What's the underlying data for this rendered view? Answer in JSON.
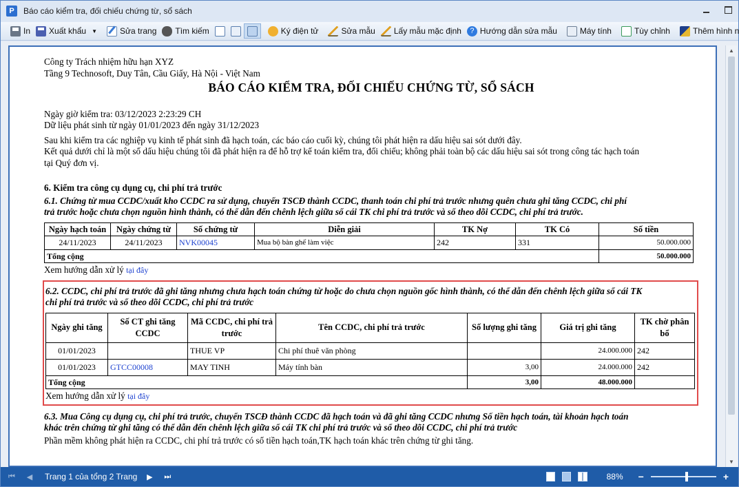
{
  "window": {
    "title": "Báo cáo kiểm tra, đối chiếu chứng từ, sổ sách",
    "app_icon_letter": "P"
  },
  "toolbar": {
    "print": "In",
    "export": "Xuất khẩu",
    "edit_template": "Sửa trang",
    "find": "Tìm kiếm",
    "sign": "Ký điện tử",
    "edit_form": "Sửa mẫu",
    "default_form": "Lấy mẫu mặc định",
    "guide": "Hướng dẫn sửa mẫu",
    "calculator": "Máy tính",
    "customize": "Tùy chỉnh",
    "more": "Thêm hình nền"
  },
  "report": {
    "company": "Công ty Trách nhiệm hữu hạn XYZ",
    "address": "Tầng 9 Technosoft, Duy Tân, Cầu Giấy, Hà Nội - Việt Nam",
    "title": "BÁO CÁO KIỂM TRA, ĐỐI CHIẾU CHỨNG TỪ, SỔ SÁCH",
    "check_time": "Ngày giờ kiểm tra: 03/12/2023 2:23:29 CH",
    "data_range": "Dữ liệu phát sinh từ ngày 01/01/2023 đến ngày 31/12/2023",
    "intro_1": "Sau khi kiểm tra các nghiệp vụ kinh tế phát sinh đã hạch toán, các báo cáo cuối kỳ, chúng tôi phát hiện ra dấu hiệu sai sót dưới đây.",
    "intro_2": "Kết quả dưới chỉ là một số dấu hiệu chúng tôi đã phát hiện ra để hỗ trợ kế toán kiểm tra, đối chiếu; không phải toàn bộ các dấu hiệu sai sót trong công tác hạch toán",
    "intro_3": "tại Quý đơn vị.",
    "section_6": "6. Kiểm tra công cụ dụng cụ, chi phí trả trước",
    "s61_title_1": "6.1. Chứng từ mua CCDC/xuất kho CCDC ra sử dụng, chuyển TSCĐ thành CCDC, thanh toán chi phí trả trước nhưng quên chưa ghi tăng CCDC, chi phí",
    "s61_title_2": "trả trước hoặc chưa chọn nguồn hình thành, có thể dẫn đến chênh lệch giữa sổ cái TK chi phí trả trước và sổ theo dõi CCDC, chi phí trả trước.",
    "s61_headers": [
      "Ngày hạch toán",
      "Ngày chứng từ",
      "Số chứng từ",
      "Diễn giải",
      "TK Nợ",
      "TK Có",
      "Số tiền"
    ],
    "s61_rows": [
      [
        "24/11/2023",
        "24/11/2023",
        "NVK00045",
        "Mua bộ bàn ghế làm việc",
        "242",
        "331",
        "50.000.000"
      ]
    ],
    "s61_total_label": "Tổng cộng",
    "s61_total": "50.000.000",
    "guide_text": "Xem hướng dẫn xử lý",
    "guide_link": "tại đây",
    "s62_title_1": "6.2. CCDC, chi phí trả trước đã ghi tăng nhưng chưa hạch toán chứng từ hoặc do chưa chọn nguồn gốc hình thành, có thể dẫn đến chênh lệch giữa sổ cái TK",
    "s62_title_2": "chi phí trả trước và sổ theo dõi CCDC, chi phí trả trước",
    "s62_headers": [
      "Ngày ghi tăng",
      "Số CT ghi tăng CCDC",
      "Mã CCDC, chi phí trả trước",
      "Tên CCDC, chi phí trả trước",
      "Số lượng ghi tăng",
      "Giá trị ghi tăng",
      "TK chờ phân bổ"
    ],
    "s62_rows": [
      [
        "01/01/2023",
        "",
        "THUE VP",
        "Chi phí thuê văn phòng",
        "",
        "24.000.000",
        "242"
      ],
      [
        "01/01/2023",
        "GTCC00008",
        "MAY TINH",
        "Máy tính bàn",
        "3,00",
        "24.000.000",
        "242"
      ]
    ],
    "s62_total_label": "Tổng cộng",
    "s62_total_qty": "3,00",
    "s62_total_value": "48.000.000",
    "s63_title_1": "6.3. Mua Công cụ dụng cụ, chi phí trả trước, chuyển TSCĐ thành CCDC đã hạch toán và đã ghi tăng CCDC nhưng Số tiền hạch toán, tài khoản hạch toán",
    "s63_title_2": "khác trên chứng từ ghi tăng có thể dẫn đến chênh lệch giữa sổ cái TK chi phí trả trước và sổ theo dõi CCDC, chi phí trả trước",
    "s63_result": "Phần mềm không phát hiện ra CCDC, chi phí trả trước có số tiền hạch toán,TK hạch toán khác trên chứng từ ghi tăng."
  },
  "status": {
    "page_label": "Trang 1 của tổng 2 Trang",
    "zoom": "88%",
    "zoom_fraction": 0.55
  },
  "colors": {
    "highlight_border": "#e04a4a",
    "link": "#1a3fcf",
    "statusbar": "#1f5ca8"
  }
}
